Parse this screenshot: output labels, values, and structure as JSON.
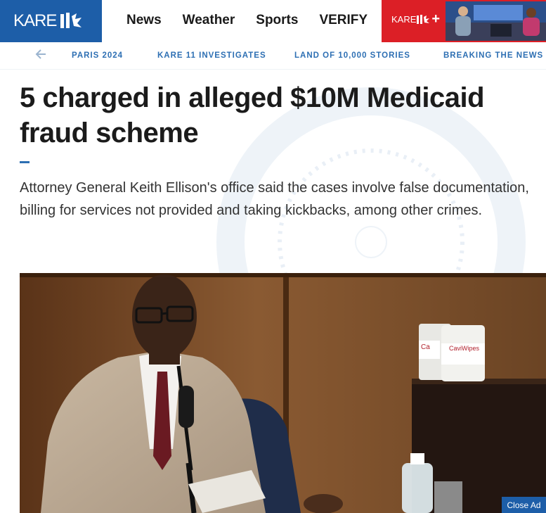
{
  "brand": {
    "name": "KARE",
    "color": "#1d5ea8"
  },
  "nav": [
    "News",
    "Weather",
    "Sports",
    "VERIFY"
  ],
  "promo": {
    "name": "KARE",
    "plus": "+",
    "color": "#dc1f26"
  },
  "sections": [
    "PARIS 2024",
    "KARE 11 INVESTIGATES",
    "LAND OF 10,000 STORIES",
    "BREAKING THE NEWS"
  ],
  "article": {
    "headline": "5 charged in alleged $10M Medicaid fraud scheme",
    "summary": "Attorney General Keith Ellison's office said the cases involve false documentation, billing for services not provided and taking kickbacks, among other crimes."
  },
  "photo": {
    "wipes_label_1": "Ca",
    "wipes_label_2": "CaviWipes"
  },
  "ad": {
    "close_label": "Close Ad"
  },
  "icons": [
    "kare11-logo-icon",
    "arrow-left-icon",
    "play-icon"
  ]
}
